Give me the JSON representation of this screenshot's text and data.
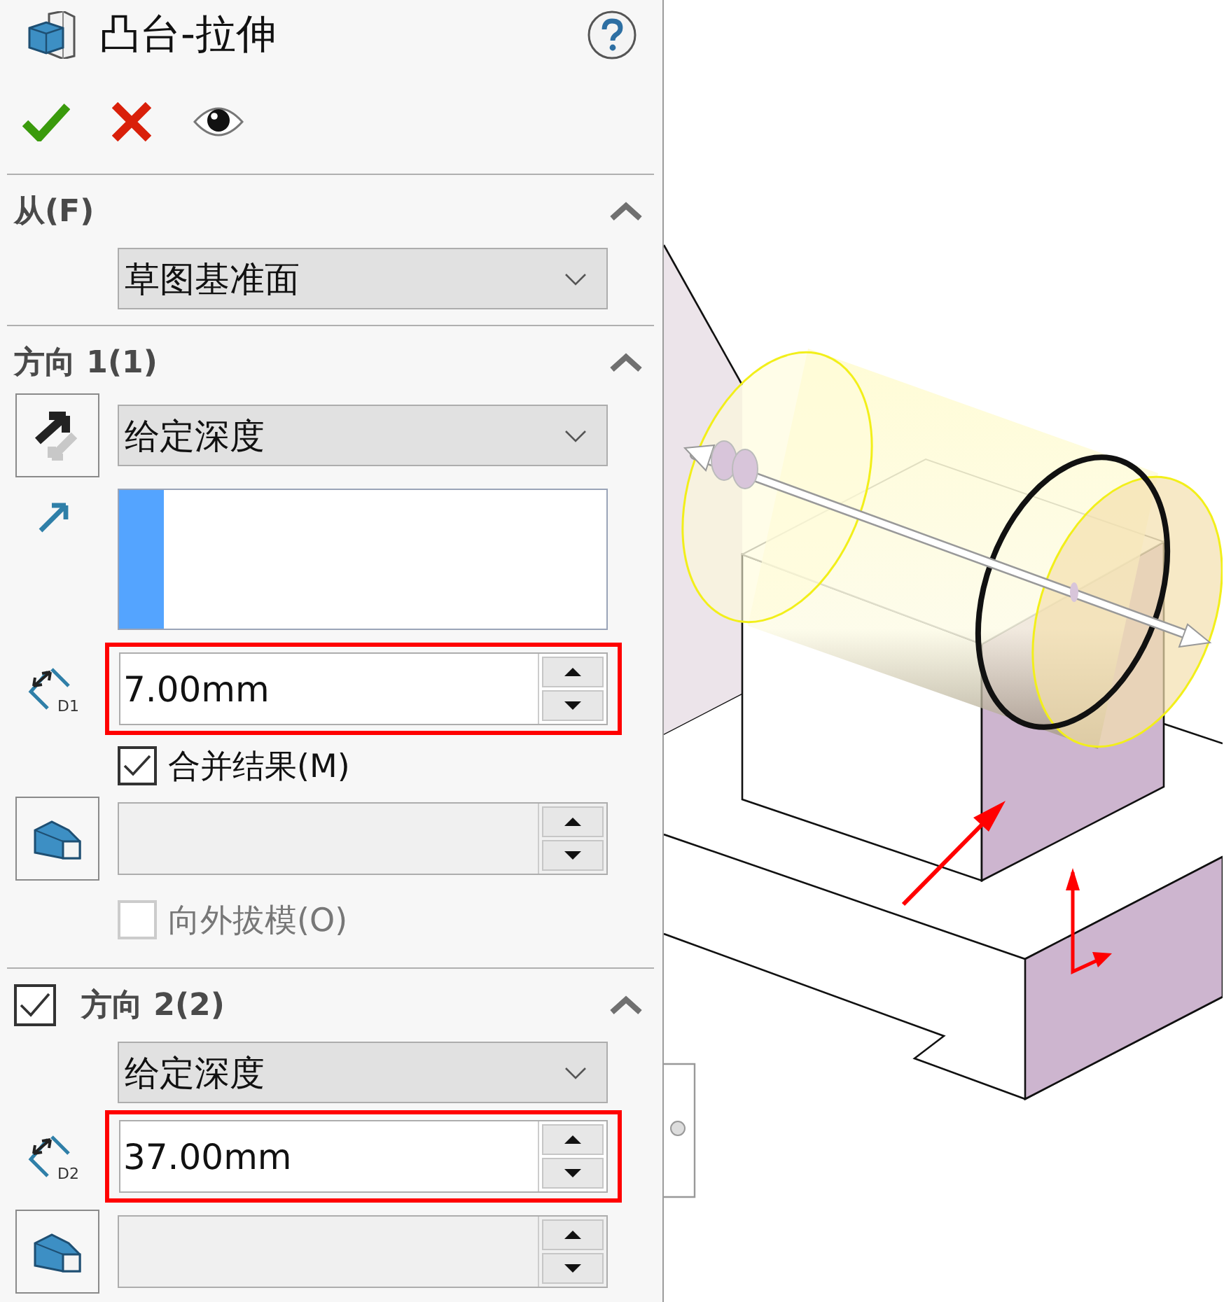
{
  "title": "凸台-拉伸",
  "from": {
    "label": "从(F)",
    "expanded": true,
    "condition": "草图基准面"
  },
  "direction1": {
    "label": "方向 1(1)",
    "expanded": true,
    "end_condition": "给定深度",
    "depth_icon_label": "D1",
    "depth": "7.00mm",
    "depth_highlighted": true,
    "merge_result": {
      "label": "合并结果(M)",
      "checked": true
    },
    "draft_outward": {
      "label": "向外拔模(O)",
      "checked": false,
      "disabled": true
    }
  },
  "direction2": {
    "label": "方向 2(2)",
    "enabled": true,
    "expanded": true,
    "end_condition": "给定深度",
    "depth_icon_label": "D2",
    "depth": "37.00mm",
    "depth_highlighted": true
  }
}
